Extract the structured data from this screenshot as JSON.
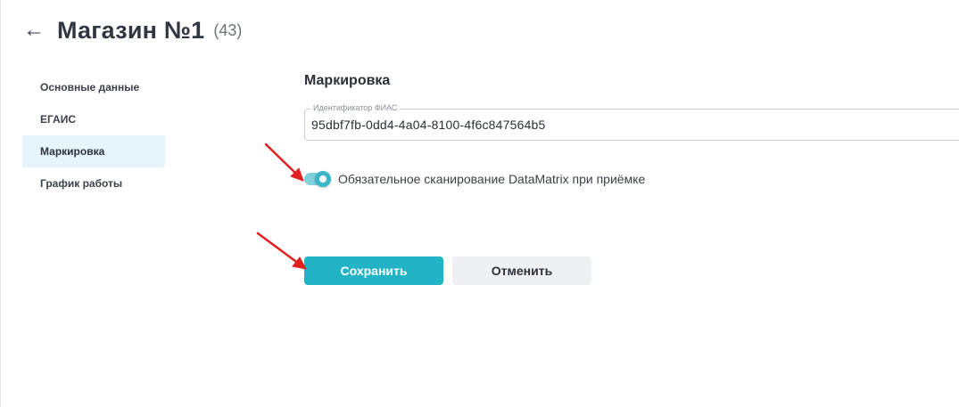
{
  "header": {
    "back_icon": "back-arrow-icon",
    "title": "Магазин №1",
    "count": "(43)"
  },
  "sidebar": {
    "items": [
      {
        "label": "Основные данные",
        "active": false
      },
      {
        "label": "ЕГАИС",
        "active": false
      },
      {
        "label": "Маркировка",
        "active": true
      },
      {
        "label": "График работы",
        "active": false
      }
    ]
  },
  "main": {
    "section_title": "Маркировка",
    "fias_field": {
      "label": "Идентификатор ФИАС",
      "value": "95dbf7fb-0dd4-4a04-8100-4f6c847564b5"
    },
    "datamatrix_toggle": {
      "label": "Обязательное сканирование DataMatrix при приёмке",
      "checked": true
    },
    "save_label": "Сохранить",
    "cancel_label": "Отменить"
  },
  "colors": {
    "accent": "#22b3c6",
    "toggle_track": "#7fd0dc",
    "sidebar_active_bg": "#e6f4fb",
    "annotation_arrow": "#e02020"
  }
}
